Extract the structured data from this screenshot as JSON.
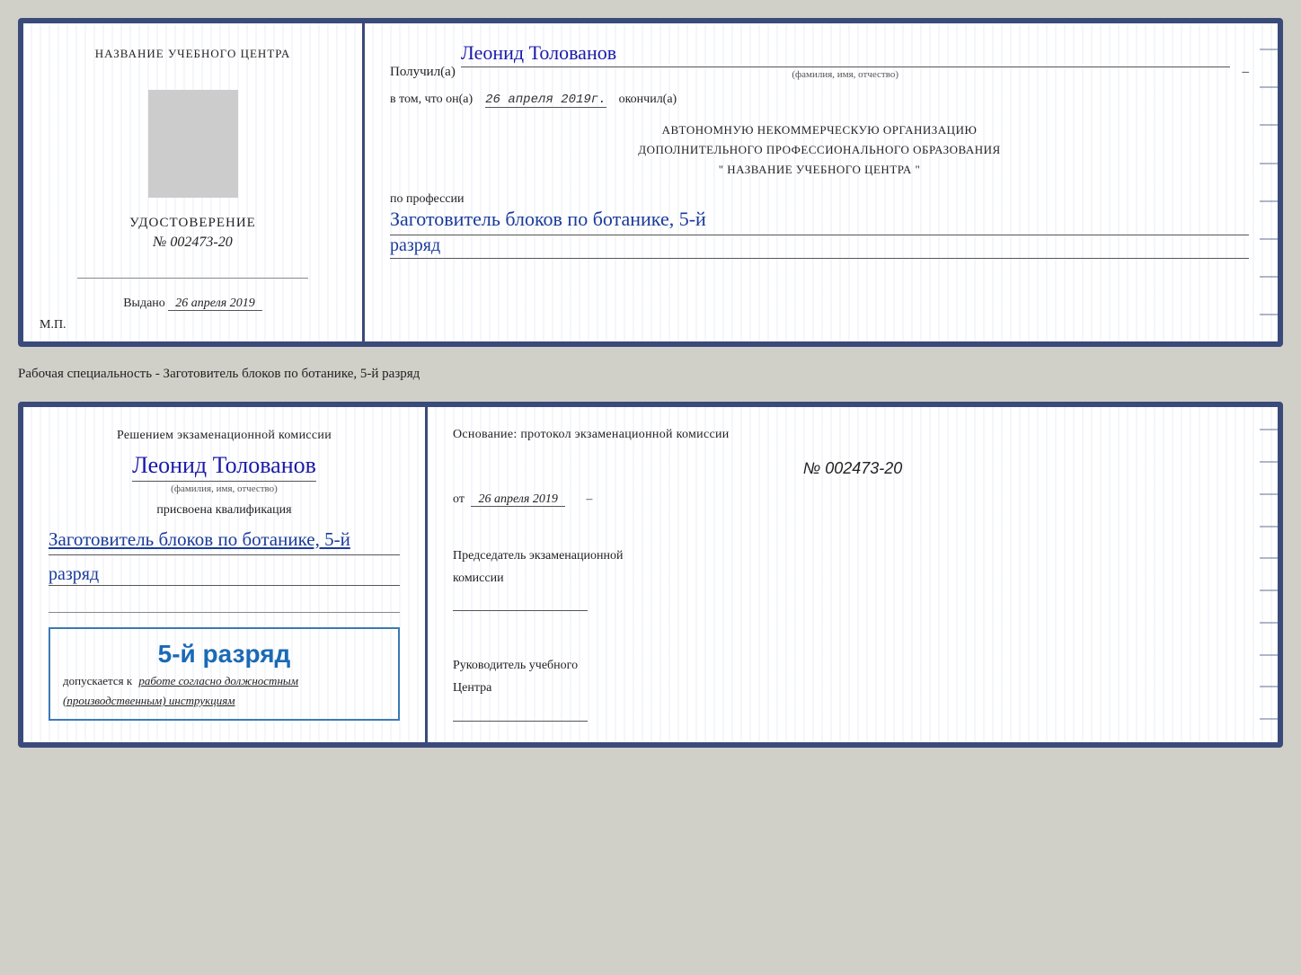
{
  "doc1": {
    "left": {
      "training_center_label": "НАЗВАНИЕ УЧЕБНОГО ЦЕНТРА",
      "udostoverenie_label": "УДОСТОВЕРЕНИЕ",
      "number": "№ 002473-20",
      "vydano_label": "Выдано",
      "vydano_date": "26 апреля 2019",
      "mp_label": "М.П."
    },
    "right": {
      "poluchil_prefix": "Получил(а)",
      "name": "Леонид Толованов",
      "fio_subtitle": "(фамилия, имя, отчество)",
      "dash": "–",
      "v_tom_prefix": "в том, что он(а)",
      "date": "26 апреля 2019г.",
      "okončil": "окончил(а)",
      "avtonom_line1": "АВТОНОМНУЮ НЕКОММЕРЧЕСКУЮ ОРГАНИЗАЦИЮ",
      "avtonom_line2": "ДОПОЛНИТЕЛЬНОГО ПРОФЕССИОНАЛЬНОГО ОБРАЗОВАНИЯ",
      "avtonom_line3": "\" НАЗВАНИЕ УЧЕБНОГО ЦЕНТРА \"",
      "po_professii": "по профессии",
      "profession": "Заготовитель блоков по ботанике, 5-й",
      "razryad": "разряд"
    }
  },
  "separator": {
    "label": "Рабочая специальность - Заготовитель блоков по ботанике, 5-й разряд"
  },
  "doc2": {
    "left": {
      "resheniem": "Решением экзаменационной комиссии",
      "name": "Леонид Толованов",
      "fio_subtitle": "(фамилия, имя, отчество)",
      "prisvoena": "присвоена квалификация",
      "profession": "Заготовитель блоков по ботанике, 5-й",
      "razryad": "разряд",
      "stamp_title": "5-й разряд",
      "dopusk_prefix": "допускается к",
      "dopusk_text": "работе согласно должностным",
      "dopusk_text2": "(производственным) инструкциям"
    },
    "right": {
      "osnovanie": "Основание: протокол экзаменационной комиссии",
      "number": "№ 002473-20",
      "ot_label": "от",
      "ot_date": "26 апреля 2019",
      "predsedatel_line1": "Председатель экзаменационной",
      "predsedatel_line2": "комиссии",
      "rukovoditel_line1": "Руководитель учебного",
      "rukovoditel_line2": "Центра"
    }
  }
}
